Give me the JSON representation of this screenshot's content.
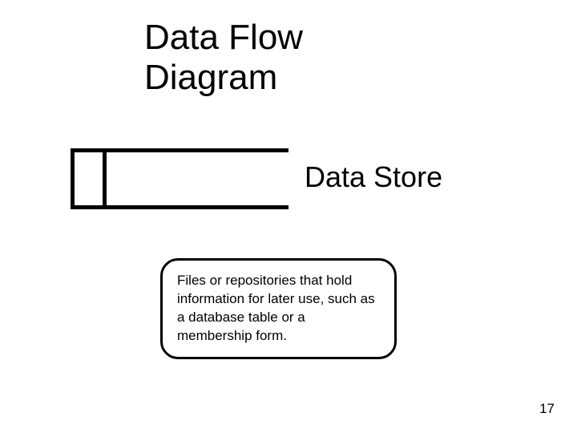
{
  "slide": {
    "title": "Data Flow Diagram",
    "symbol_label": "Data Store",
    "definition": "Files or repositories that hold information for later use, such as a database table or a membership form.",
    "page_number": "17"
  }
}
